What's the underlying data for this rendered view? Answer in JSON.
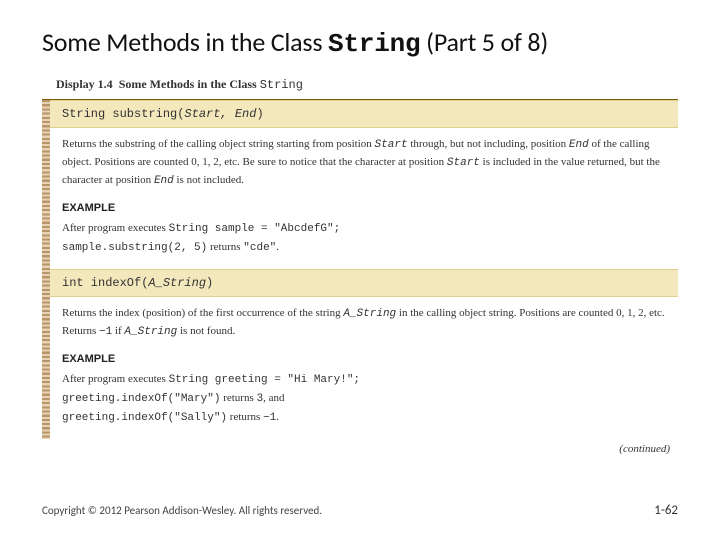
{
  "title": {
    "pre": "Some Methods in the Class ",
    "mono": "String",
    "post": " (Part 5 of 8)"
  },
  "display": {
    "label": "Display 1.4",
    "caption_pre": "Some Methods in the Class ",
    "caption_mono": "String"
  },
  "methods": [
    {
      "sig_pre": "String substring(",
      "sig_args": "Start, End",
      "sig_post": ")",
      "desc_html": "Returns the substring of the calling object string starting from position <span class='i m'>Start</span> through, but not including, position <span class='i m'>End</span> of the calling object. Positions are counted 0, 1, 2, etc. Be sure to notice that the character at position <span class='i m'>Start</span> is included in the value returned, but the character at position <span class='i m'>End</span> is not included.",
      "example_label": "EXAMPLE",
      "example_html": "After program executes <span class='m'>String sample = \"AbcdefG\";</span><br><span class='m'>sample.substring(2, 5)</span> returns <span class='m'>\"cde\"</span>."
    },
    {
      "sig_pre": "int indexOf(",
      "sig_args": "A_String",
      "sig_post": ")",
      "desc_html": "Returns the index (position) of the first occurrence of the string <span class='i m'>A_String</span> in the calling object string. Positions are counted 0, 1, 2, etc. Returns <span class='m'>&minus;1</span> if <span class='i m'>A_String</span> is not found.",
      "example_label": "EXAMPLE",
      "example_html": "After program executes <span class='m'>String greeting = \"Hi Mary!\";</span><br><span class='m'>greeting.indexOf(\"Mary\")</span> returns <span class='m'>3</span>, and<br><span class='m'>greeting.indexOf(\"Sally\")</span> returns <span class='m'>&minus;1</span>."
    }
  ],
  "continued": "(continued)",
  "footer": {
    "copyright": "Copyright © 2012 Pearson Addison-Wesley. All rights reserved.",
    "pagenum": "1-62"
  }
}
